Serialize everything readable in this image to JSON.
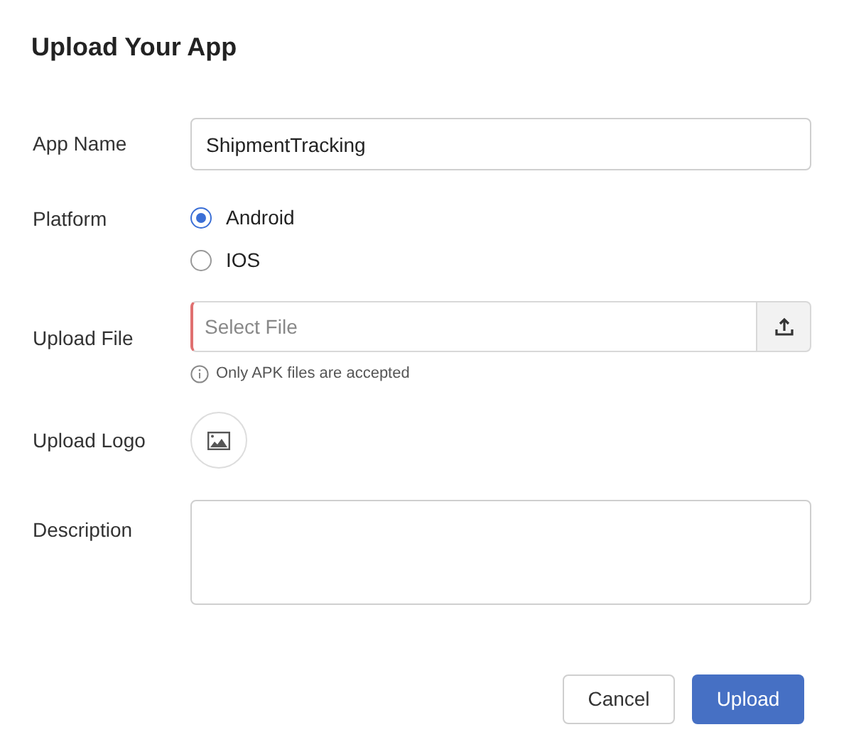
{
  "title": "Upload Your App",
  "app_name": {
    "label": "App Name",
    "value": "ShipmentTracking"
  },
  "platform": {
    "label": "Platform",
    "options": [
      {
        "label": "Android",
        "selected": true
      },
      {
        "label": "IOS",
        "selected": false
      }
    ]
  },
  "upload_file": {
    "label": "Upload File",
    "placeholder": "Select File",
    "invalid": true,
    "hint": "Only APK files are accepted"
  },
  "upload_logo": {
    "label": "Upload Logo"
  },
  "description": {
    "label": "Description"
  },
  "buttons": [
    {
      "label": "Cancel",
      "kind": "secondary"
    },
    {
      "label": "Upload",
      "kind": "primary"
    }
  ]
}
